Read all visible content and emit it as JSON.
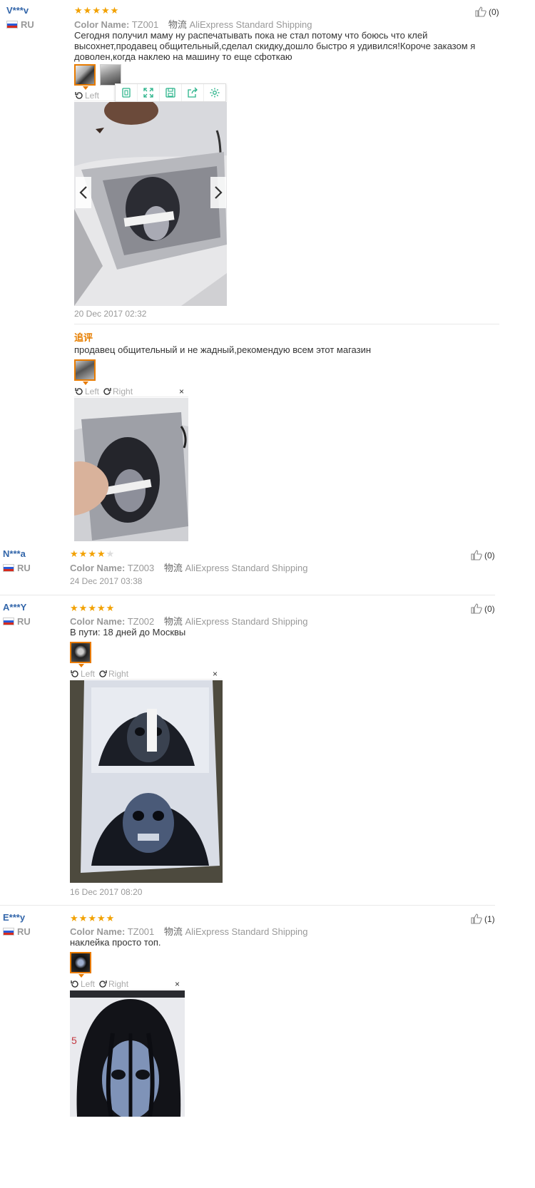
{
  "labels": {
    "color_name": "Color Name:",
    "shipping": "物流",
    "left": "Left",
    "right": "Right",
    "additional": "追评",
    "close": "×"
  },
  "reviews": [
    {
      "user": "V***v",
      "country": "RU",
      "rating": 5,
      "color": "TZ001",
      "shipping": "AliExpress Standard Shipping",
      "text": "Сегодня получил маму ну распечатывать пока не стал потому что боюсь что клей высохнет,продавец общительный,сделал скидку,дошло быстро я удивился!Короче заказом я доволен,когда наклею на машину то еще сфоткаю",
      "date": "20 Dec 2017 02:32",
      "helpful": "(0)",
      "additional": {
        "text": "продавец общительный и не жадный,рекомендую всем этот магазин"
      }
    },
    {
      "user": "N***a",
      "country": "RU",
      "rating": 4,
      "color": "TZ003",
      "shipping": "AliExpress Standard Shipping",
      "date": "24 Dec 2017 03:38",
      "helpful": "(0)"
    },
    {
      "user": "A***Y",
      "country": "RU",
      "rating": 5,
      "color": "TZ002",
      "shipping": "AliExpress Standard Shipping",
      "text": "В пути: 18 дней до Москвы",
      "date": "16 Dec 2017 08:20",
      "helpful": "(0)"
    },
    {
      "user": "E***y",
      "country": "RU",
      "rating": 5,
      "color": "TZ001",
      "shipping": "AliExpress Standard Shipping",
      "text": "наклейка просто топ.",
      "helpful": "(1)"
    }
  ],
  "colors": {
    "star": "#f2a100",
    "user": "#3366aa",
    "accent": "#e87b00",
    "toolbar_icon": "#2ab38a"
  },
  "icons": [
    "thumbs-up-icon",
    "rotate-left-icon",
    "rotate-right-icon",
    "fit-icon",
    "fullscreen-icon",
    "save-icon",
    "share-icon",
    "settings-icon",
    "chevron-left-icon",
    "chevron-right-icon",
    "close-icon",
    "flag-ru-icon"
  ]
}
